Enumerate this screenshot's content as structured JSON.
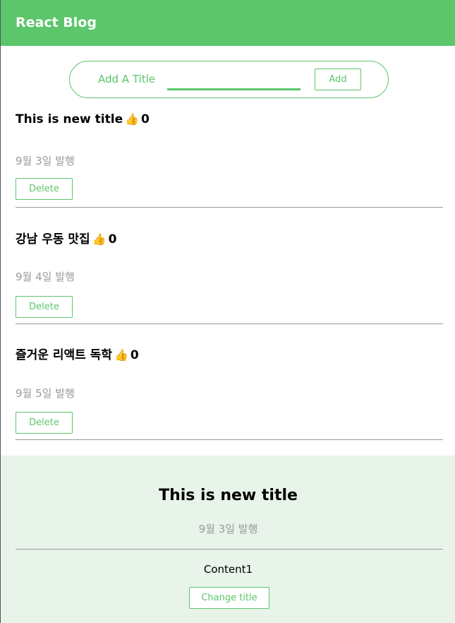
{
  "header": {
    "brand": "React Blog"
  },
  "add_form": {
    "placeholder": "Add A Title",
    "value": "",
    "add_label": "Add"
  },
  "posts": [
    {
      "title": "This is new title",
      "likes": "0",
      "date": "9월 3일 발행",
      "delete_label": "Delete"
    },
    {
      "title": "강남 우동 맛집",
      "likes": "0",
      "date": "9월 4일 발행",
      "delete_label": "Delete"
    },
    {
      "title": "즐거운 리액트 독학",
      "likes": "0",
      "date": "9월 5일 발행",
      "delete_label": "Delete"
    }
  ],
  "like_icon": "👍",
  "detail": {
    "title": "This is new title",
    "date": "9월 3일 발행",
    "content": "Content1",
    "change_label": "Change title"
  },
  "colors": {
    "accent": "#5bc66a",
    "detail_bg": "#e8f3ea",
    "muted": "#9a9a9a"
  }
}
